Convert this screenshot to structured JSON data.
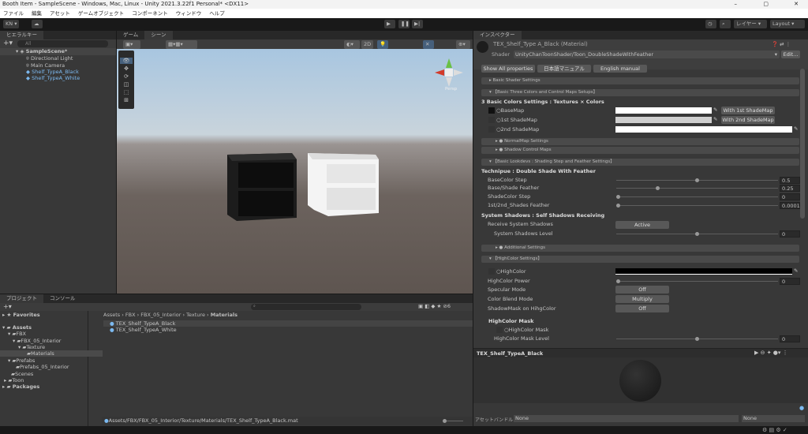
{
  "window": {
    "title": "Booth Item - SampleScene - Windows, Mac, Linux - Unity 2021.3.22f1 Personal* <DX11>",
    "min": "–",
    "max": "▢",
    "close": "✕"
  },
  "menu": [
    "ファイル",
    "編集",
    "アセット",
    "ゲームオブジェクト",
    "コンポーネント",
    "ウィンドウ",
    "ヘルプ"
  ],
  "toolbar": {
    "account": "KN ▾",
    "layers": "レイヤー",
    "layout": "Layout"
  },
  "hierarchy": {
    "tab": "ヒエラルキー",
    "search_placeholder": "All",
    "items": [
      {
        "label": "SampleScene*"
      },
      {
        "label": "Directional Light"
      },
      {
        "label": "Main Camera"
      },
      {
        "label": "Shelf_TypeA_Black"
      },
      {
        "label": "Shelf_TypeA_White"
      }
    ]
  },
  "scene": {
    "tabs": [
      "ゲーム",
      "シーン"
    ],
    "mode_2d": "2D",
    "persp": "Persp"
  },
  "inspector": {
    "tab": "インスペクター",
    "material_title": "TEX_Shelf_Type A_Black (Material)",
    "shader_label": "Shader",
    "shader_value": "UnityChanToonShader/Toon_DoubleShadeWithFeather",
    "edit": "Edit...",
    "buttons": [
      "Show All properties",
      "日本語マニュアル",
      "English manual"
    ],
    "basic_shader": "Basic Shader Settings",
    "three_colors": "【Basic Three Colors and Control Maps Setups】",
    "colors_heading": "3 Basic Colors Settings : Textures × Colors",
    "basemap": "BaseMap",
    "shade1": "1st ShadeMap",
    "shade2": "2nd ShadeMap",
    "with1": "With 1st ShadeMap",
    "with2": "With 2nd ShadeMap",
    "normalmap": "NormalMap Settings",
    "shadow_maps": "Shadow Control Maps",
    "lookdevs": "【Basic Lookdevs : Shading Step and Feather Settings】",
    "technique": "Technipue : Double Shade With Feather",
    "sliders": [
      {
        "label": "BaseColor Step",
        "value": "0.5",
        "frac": 0.5
      },
      {
        "label": "Base/Shade Feather",
        "value": "0.25",
        "frac": 0.25
      },
      {
        "label": "ShadeColor Step",
        "value": "0",
        "frac": 0
      },
      {
        "label": "1st/2nd_Shades Feather",
        "value": "0.0001",
        "frac": 0
      }
    ],
    "system_shadows": "System Shadows : Self Shadows Receiving",
    "receive": "Receive System Shadows",
    "receive_value": "Active",
    "shadow_level": "System Shadows Level",
    "shadow_level_value": "0",
    "shadow_level_frac": 0.5,
    "additional": "Additional Settings",
    "highcolor_settings": "【HighColor Settings】",
    "highcolor": "HighColor",
    "hc_power": "HighColor Power",
    "hc_power_value": "0",
    "specular": "Specular Mode",
    "specular_value": "Off",
    "blend": "Color Blend Mode",
    "blend_value": "Multiply",
    "shadowmask": "ShadowMask on HihgColor",
    "shadowmask_value": "Off",
    "hc_mask_heading": "HighColor Mask",
    "hc_mask": "HighColor Mask",
    "hc_mask_level": "HighColor Mask Level",
    "hc_mask_level_value": "0",
    "preview_title": "TEX_Shelf_TypeA_Black",
    "assetbundle_label": "アセットバンドル",
    "assetbundle": "None",
    "variant": "None"
  },
  "project": {
    "tabs": [
      "プロジェクト",
      "コンソール"
    ],
    "tree": [
      "Favorites",
      "Assets",
      "FBX",
      "FBX_05_Interior",
      "Texture",
      "Materials",
      "Prefabs",
      "Prefabs_05_Interior",
      "Scenes",
      "Toon",
      "Packages"
    ],
    "breadcrumb": [
      "Assets",
      "FBX",
      "FBX_05_Interior",
      "Texture",
      "Materials"
    ],
    "files": [
      "TEX_Shelf_TypeA_Black",
      "TEX_Shelf_TypeA_White"
    ],
    "hidden_count": "6",
    "path": "Assets/FBX/FBX_05_Interior/Texture/Materials/TEX_Shelf_TypeA_Black.mat"
  }
}
